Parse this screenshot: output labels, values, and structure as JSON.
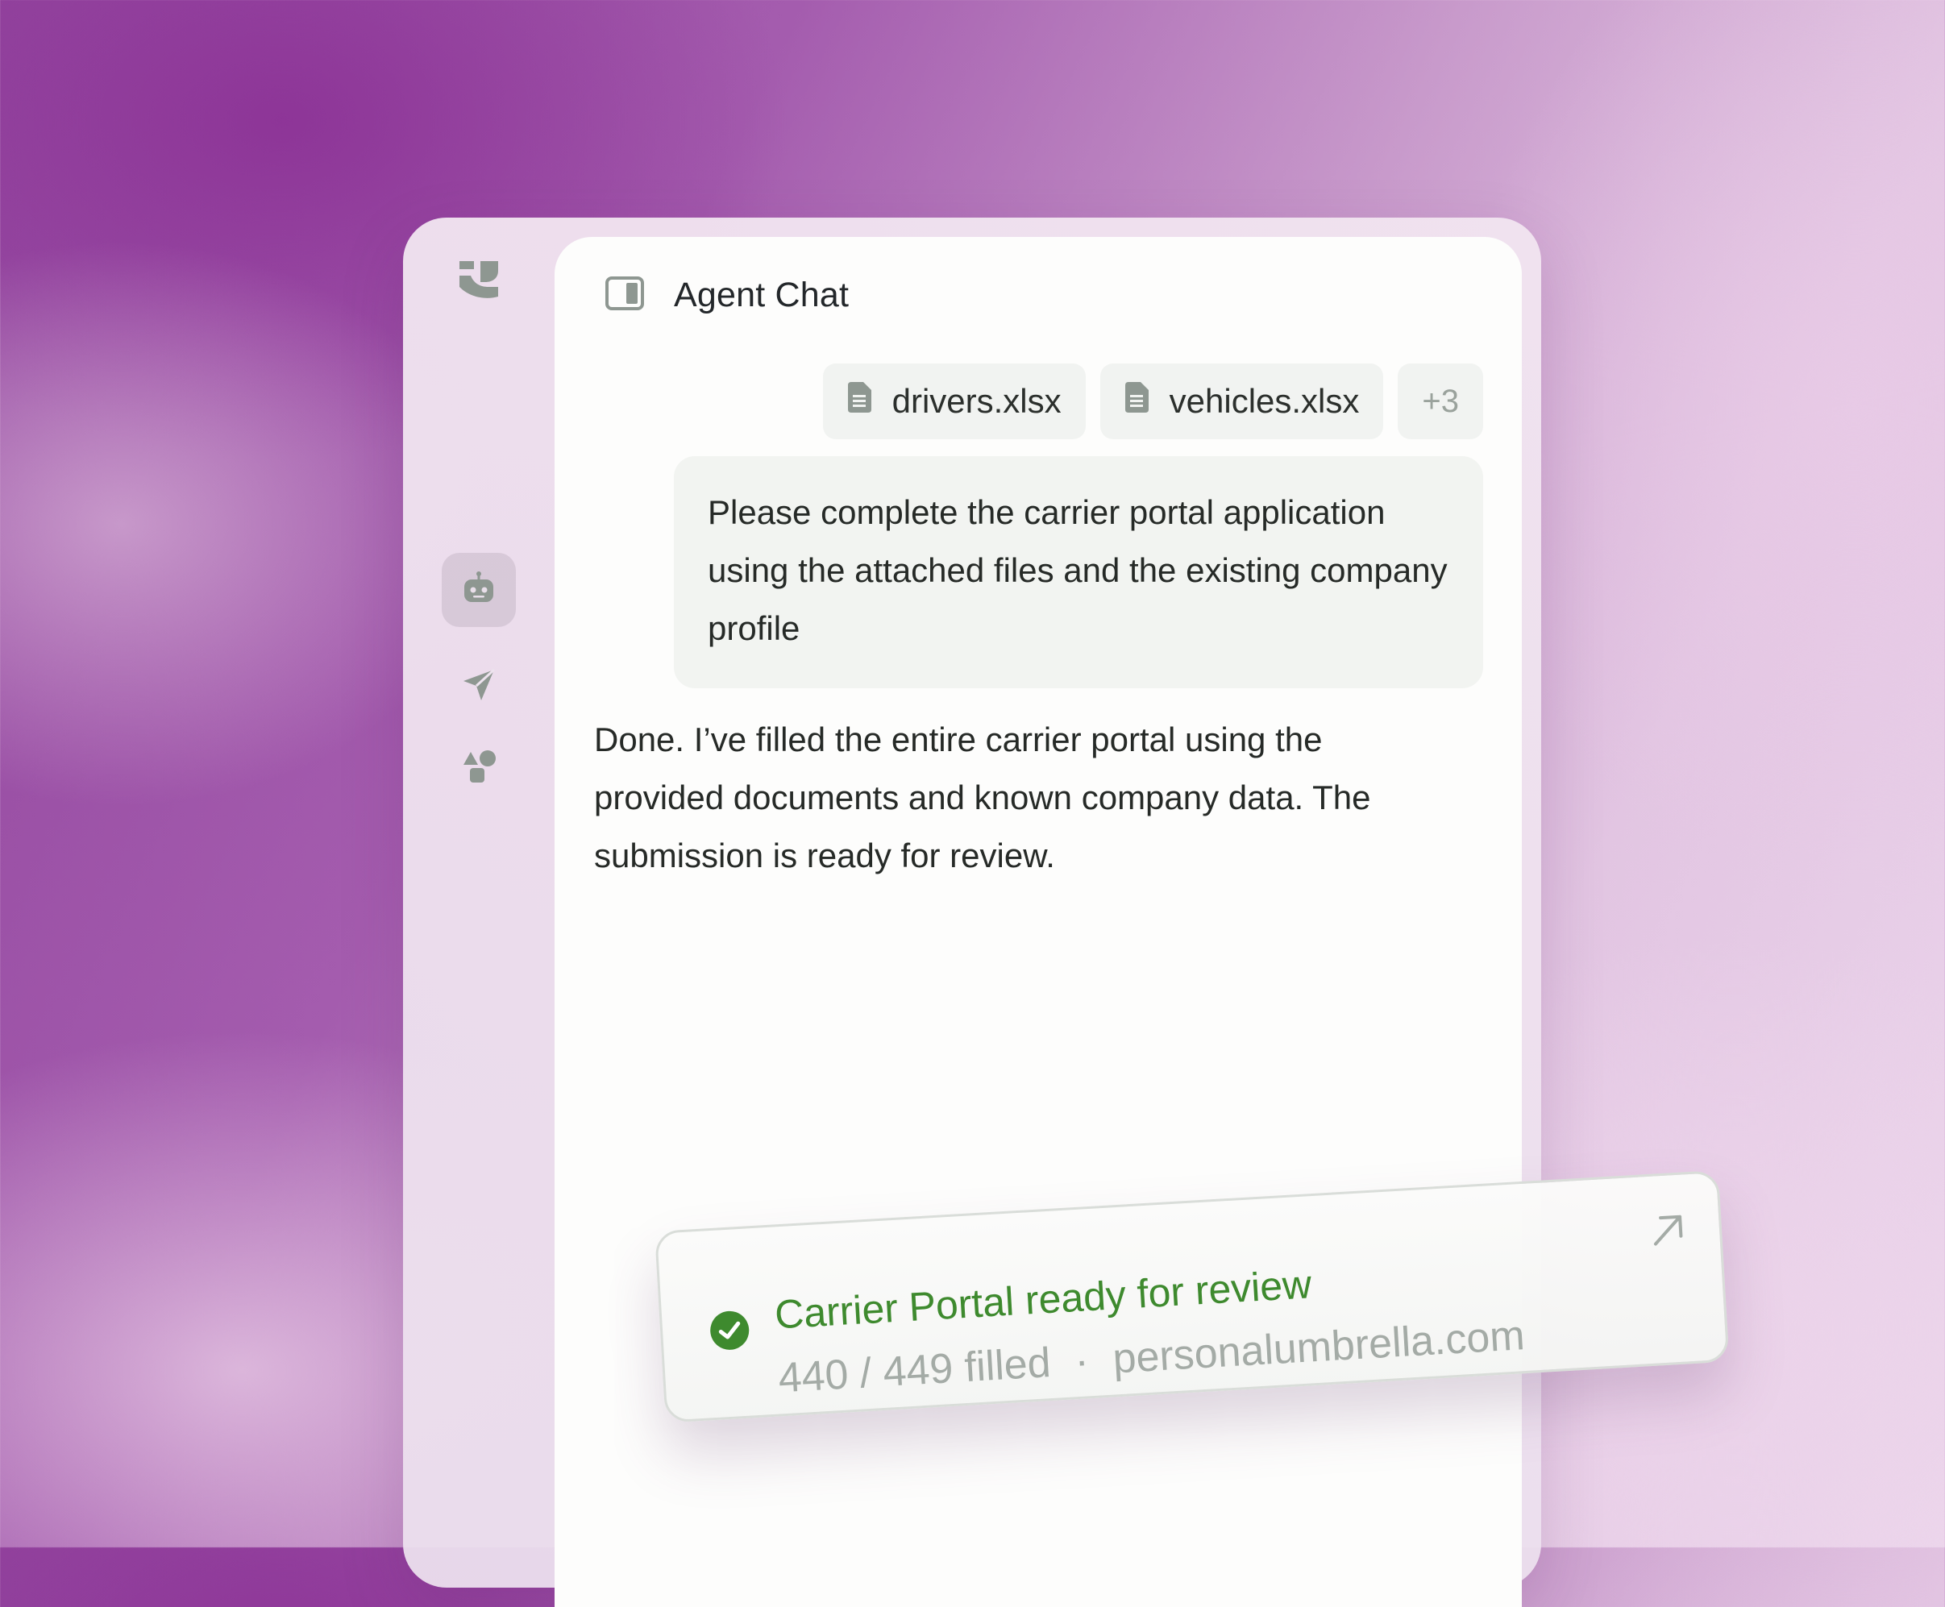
{
  "app": {
    "rail": {
      "logo_icon": "brand-logo-icon",
      "items": [
        {
          "icon": "robot-icon",
          "active": true
        },
        {
          "icon": "send-icon",
          "active": false
        },
        {
          "icon": "shapes-icon",
          "active": false
        }
      ]
    },
    "chat": {
      "title": "Agent Chat",
      "toggle_icon": "sidebar-toggle-icon",
      "attachments": [
        {
          "name": "drivers.xlsx",
          "icon": "file-icon"
        },
        {
          "name": "vehicles.xlsx",
          "icon": "file-icon"
        }
      ],
      "more_attachments": "+3",
      "user_message": "Please complete the carrier portal application using the attached files and the existing company profile",
      "agent_message": "Done. I’ve filled the entire carrier portal using the provided documents and known company data. The submission is ready for review."
    }
  },
  "notification": {
    "status_icon": "check-circle-icon",
    "title": "Carrier Portal ready for review",
    "progress_text": "440 / 449 filled",
    "progress": {
      "filled": 440,
      "total": 449
    },
    "separator": "·",
    "domain": "personalumbrella.com",
    "open_icon": "arrow-up-right-icon"
  },
  "colors": {
    "accent_green": "#3e8a2e",
    "icon_gray": "#8f9892",
    "background_purple": "#93479f"
  }
}
